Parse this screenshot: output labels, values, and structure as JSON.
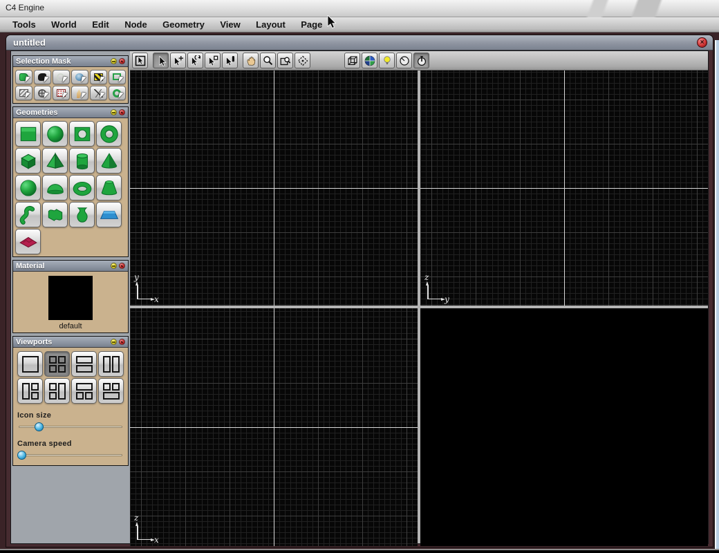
{
  "os_titlebar": {
    "title": "C4 Engine"
  },
  "menu_bar": {
    "items": [
      "Tools",
      "World",
      "Edit",
      "Node",
      "Geometry",
      "View",
      "Layout",
      "Page"
    ]
  },
  "window": {
    "title": "untitled",
    "close_label": "×"
  },
  "toolbar": {
    "tools": [
      "box-select",
      "select",
      "move",
      "rotate",
      "resize",
      "scale",
      "pan",
      "zoom",
      "zoom-box",
      "frame-all"
    ],
    "selected_tool": "select",
    "view_tools": [
      "wireframe-view",
      "world-axes",
      "lighting",
      "backface-view",
      "gauge-view"
    ],
    "selected_view_tool": "gauge-view"
  },
  "panels": {
    "selection_mask": {
      "title": "Selection Mask",
      "masks": [
        "geometry",
        "model",
        "light",
        "space",
        "trigger",
        "marker",
        "zone",
        "camera",
        "emitter",
        "effect",
        "instance",
        "portal"
      ]
    },
    "geometries": {
      "title": "Geometries",
      "primitives": [
        "plate",
        "disk",
        "hole-plate",
        "annulus",
        "box",
        "pyramid",
        "cylinder",
        "cone",
        "sphere",
        "dome",
        "torus",
        "truncated-cone",
        "tube",
        "extrusion",
        "revolution",
        "water-plane",
        "terrain-plane"
      ]
    },
    "material": {
      "title": "Material",
      "selected_material": "default"
    },
    "viewports": {
      "title": "Viewports",
      "layouts": [
        "single",
        "quad",
        "two-rows",
        "two-columns",
        "pane-left-split-right",
        "split-left-pane-right",
        "pane-top-split-bottom",
        "split-top-pane-bottom"
      ],
      "selected_layout": "quad",
      "icon_size": {
        "label": "Icon size",
        "thumb_style": "left:16%"
      },
      "camera_speed": {
        "label": "Camera speed",
        "thumb_style": "left:0%"
      }
    }
  },
  "viewport_area": {
    "top_left": {
      "vertical_axis": "y",
      "horizontal_axis": "x"
    },
    "top_right": {
      "vertical_axis": "z",
      "horizontal_axis": "y"
    },
    "bottom_left": {
      "vertical_axis": "z",
      "horizontal_axis": "x"
    },
    "bottom_right": {
      "type": "perspective"
    }
  },
  "colors": {
    "panel_body": "#cab28e",
    "frame_maroon": "#3a2327",
    "geometry_green": "#1fa53e",
    "water_blue": "#2e8fd0",
    "terrain_red": "#b51f4e",
    "slider_thumb_blue": "#2ea0d8",
    "grid_minor": "#212121",
    "grid_major": "#3e3e3e",
    "grid_axis": "#d9d9d9"
  }
}
